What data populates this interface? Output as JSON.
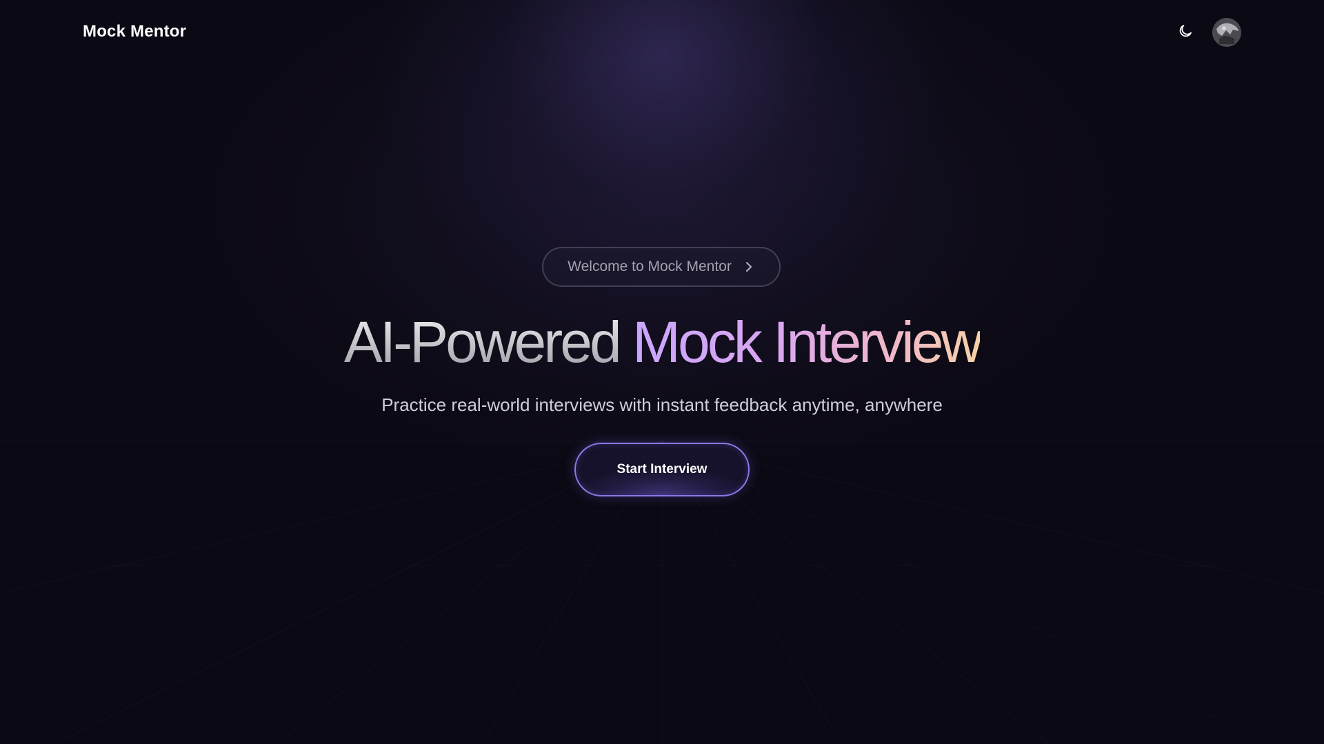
{
  "app": {
    "brand": "Mock Mentor"
  },
  "header": {
    "theme_toggle_icon": "moon-icon",
    "avatar_icon": "user-avatar"
  },
  "hero": {
    "badge_label": "Welcome to Mock Mentor",
    "badge_icon": "chevron-right-icon",
    "title_part1": "AI-Powered ",
    "title_part2": "Mock Interview",
    "subtitle": "Practice real-world interviews with instant feedback anytime, anywhere",
    "cta_label": "Start Interview"
  },
  "colors": {
    "background": "#0b0913",
    "accent_border": "#8c78e6",
    "title_gradient_start": "#c9a6ff",
    "title_gradient_end": "#f6d0a8"
  }
}
